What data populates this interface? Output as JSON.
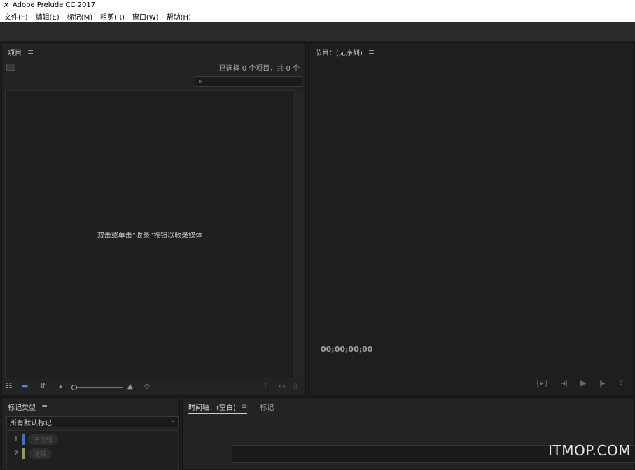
{
  "window": {
    "title": "Adobe Prelude CC 2017"
  },
  "menu": [
    "文件(F)",
    "编辑(E)",
    "标记(M)",
    "粗剪(R)",
    "窗口(W)",
    "帮助(H)"
  ],
  "project_panel": {
    "title": "项目",
    "count_text": "已选择 0 个项目，共 0 个",
    "search_placeholder": "",
    "empty_message": "双击或单击“收录”按钮以收录媒体"
  },
  "program_panel": {
    "title": "节目：(无序列)",
    "timecode": "00;00;00;00"
  },
  "marker_panel": {
    "title": "标记类型",
    "dropdown_value": "所有默认标记",
    "markers": [
      {
        "num": "1",
        "label": "子剪辑",
        "color": "#3a6fd8"
      },
      {
        "num": "2",
        "label": "注释",
        "color": "#8aa04a"
      }
    ]
  },
  "timeline_panel": {
    "tab_active": "时间轴：(空白)",
    "tab_other": "标记"
  },
  "watermark": "ITMOP.COM",
  "colors": {
    "accent": "#3a6fd8",
    "panel_bg": "#232323",
    "menubar_bg": "#ffffff"
  }
}
